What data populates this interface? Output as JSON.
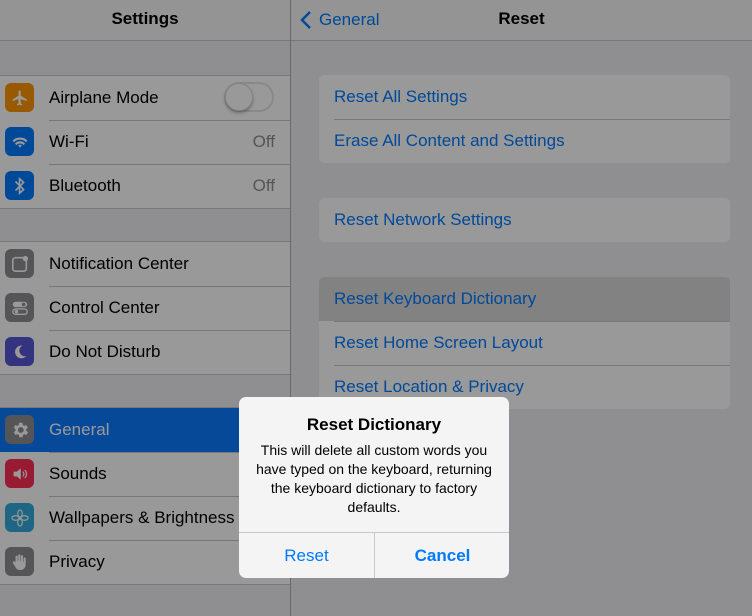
{
  "left": {
    "title": "Settings",
    "groups": [
      [
        {
          "label": "Airplane Mode",
          "icon": "airplane-icon",
          "icon_color": "#ff9500",
          "toggle": false
        },
        {
          "label": "Wi-Fi",
          "value": "Off",
          "icon": "wifi-icon",
          "icon_color": "#007aff"
        },
        {
          "label": "Bluetooth",
          "value": "Off",
          "icon": "bluetooth-icon",
          "icon_color": "#007aff"
        }
      ],
      [
        {
          "label": "Notification Center",
          "icon": "notification-center-icon",
          "icon_color": "#8e8e93"
        },
        {
          "label": "Control Center",
          "icon": "control-center-icon",
          "icon_color": "#8e8e93"
        },
        {
          "label": "Do Not Disturb",
          "icon": "moon-icon",
          "icon_color": "#5856d6"
        }
      ],
      [
        {
          "label": "General",
          "icon": "gear-icon",
          "icon_color": "#8e8e93",
          "selected": true
        },
        {
          "label": "Sounds",
          "icon": "speaker-icon",
          "icon_color": "#ff2d55"
        },
        {
          "label": "Wallpapers & Brightness",
          "icon": "flower-icon",
          "icon_color": "#34aadc"
        },
        {
          "label": "Privacy",
          "icon": "hand-icon",
          "icon_color": "#8e8e93"
        }
      ]
    ]
  },
  "right": {
    "back_label": "General",
    "title": "Reset",
    "groups": [
      [
        "Reset All Settings",
        "Erase All Content and Settings"
      ],
      [
        "Reset Network Settings"
      ],
      [
        "Reset Keyboard Dictionary",
        "Reset Home Screen Layout",
        "Reset Location & Privacy"
      ]
    ],
    "highlighted": "Reset Keyboard Dictionary"
  },
  "alert": {
    "title": "Reset Dictionary",
    "message": "This will delete all custom words you have typed on the keyboard, returning the keyboard dictionary to factory defaults.",
    "reset_label": "Reset",
    "cancel_label": "Cancel"
  },
  "colors": {
    "accent": "#007aff",
    "selected_row": "#0a7bff"
  }
}
